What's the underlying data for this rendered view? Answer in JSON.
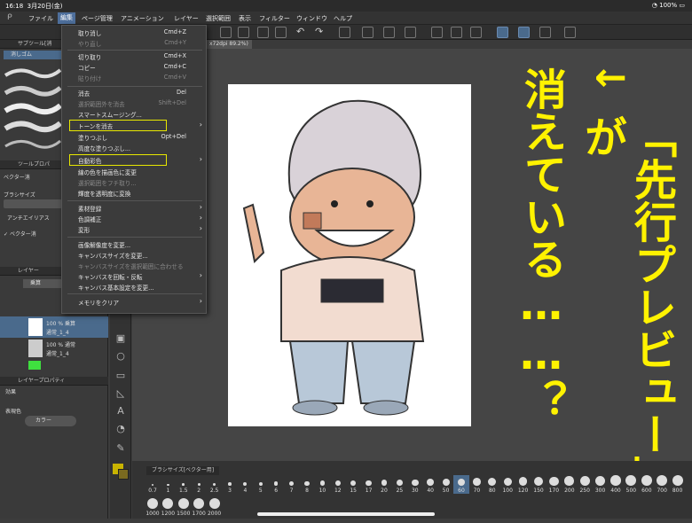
{
  "status": {
    "time": "16:18",
    "date": "3月20日(金)",
    "battery": "100%"
  },
  "menubar": {
    "items": [
      "ファイル",
      "編集",
      "ページ管理",
      "アニメーション",
      "レイヤー",
      "選択範囲",
      "表示",
      "フィルター",
      "ウィンドウ",
      "ヘルプ"
    ]
  },
  "canvas_tab": "x72dpi 89.2%)",
  "left": {
    "subtool_title": "サブツール[消",
    "subtool_item": "消しゴム",
    "toolprop_title": "ツールプロパ",
    "vector_label": "ベクター消",
    "brush_size_label": "ブラシサイズ",
    "antialias_label": "アンチエイリアス",
    "vector_erase_label": "ベクター消",
    "layer_title": "レイヤー",
    "blend_mode": "乗算",
    "layer1_opacity": "100 % 乗算",
    "layer1_name": "通常_1_4",
    "layer2_opacity": "100 % 通常",
    "layer2_name": "通常_1_4",
    "layerprop_title": "レイヤープロパティ",
    "effect_label": "効果",
    "express_label": "表現色",
    "color_value": "カラー"
  },
  "edit_menu": [
    {
      "label": "取り消し",
      "shortcut": "Cmd+Z",
      "disabled": false
    },
    {
      "label": "やり直し",
      "shortcut": "Cmd+Y",
      "disabled": true
    },
    {
      "label": "切り取り",
      "shortcut": "Cmd+X",
      "disabled": false
    },
    {
      "label": "コピー",
      "shortcut": "Cmd+C",
      "disabled": false
    },
    {
      "label": "貼り付け",
      "shortcut": "Cmd+V",
      "disabled": true
    },
    {
      "label": "消去",
      "shortcut": "Del",
      "disabled": false
    },
    {
      "label": "選択範囲外を消去",
      "shortcut": "Shift+Del",
      "disabled": true
    },
    {
      "label": "スマートスムージング...",
      "shortcut": "",
      "disabled": false
    },
    {
      "label": "トーンを消去",
      "shortcut": "",
      "disabled": false,
      "submenu": true
    },
    {
      "label": "塗りつぶし",
      "shortcut": "Opt+Del",
      "disabled": false
    },
    {
      "label": "高度な塗りつぶし...",
      "shortcut": "",
      "disabled": false
    },
    {
      "label": "自動彩色",
      "shortcut": "",
      "disabled": false,
      "submenu": true
    },
    {
      "label": "線の色を描画色に変更",
      "shortcut": "",
      "disabled": false
    },
    {
      "label": "選択範囲をフチ取り...",
      "shortcut": "",
      "disabled": true
    },
    {
      "label": "輝度を透明度に変換",
      "shortcut": "",
      "disabled": false
    },
    {
      "label": "素材登録",
      "shortcut": "",
      "disabled": false,
      "submenu": true
    },
    {
      "label": "色調補正",
      "shortcut": "",
      "disabled": false,
      "submenu": true
    },
    {
      "label": "変形",
      "shortcut": "",
      "disabled": false,
      "submenu": true
    },
    {
      "label": "画像解像度を変更...",
      "shortcut": "",
      "disabled": false
    },
    {
      "label": "キャンバスサイズを変更...",
      "shortcut": "",
      "disabled": false
    },
    {
      "label": "キャンバスサイズを選択範囲に合わせる",
      "shortcut": "",
      "disabled": true
    },
    {
      "label": "キャンバスを回転・反転",
      "shortcut": "",
      "disabled": false,
      "submenu": true
    },
    {
      "label": "キャンバス基本設定を変更...",
      "shortcut": "",
      "disabled": false
    },
    {
      "label": "メモリをクリア",
      "shortcut": "",
      "disabled": false,
      "submenu": true
    }
  ],
  "annotation": {
    "arrow": "←",
    "col1": "消えている……？",
    "col2": "「先行プレビュー」が",
    "color": "#fff200"
  },
  "brush_panel": {
    "title": "ブラシサイズ[ベクター用]",
    "sizes": [
      "0.7",
      "1",
      "1.5",
      "2",
      "2.5",
      "3",
      "4",
      "5",
      "6",
      "7",
      "8",
      "10",
      "12",
      "15",
      "17",
      "20",
      "25",
      "30",
      "40",
      "50",
      "60",
      "70",
      "80",
      "100",
      "120",
      "150",
      "170",
      "200",
      "250",
      "300",
      "400",
      "500",
      "600",
      "700",
      "800",
      "1000",
      "1200",
      "1500",
      "1700",
      "2000"
    ],
    "selected": "60"
  }
}
